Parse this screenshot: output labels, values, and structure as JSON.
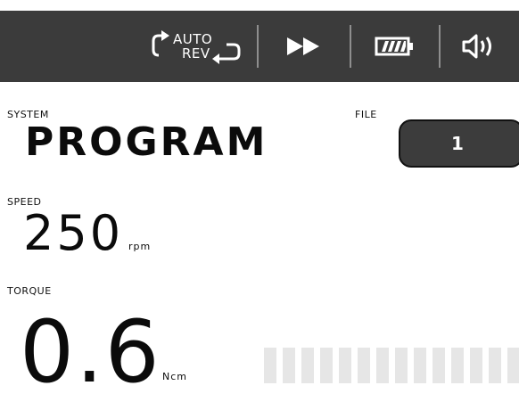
{
  "topbar": {
    "auto_label": "AUTO",
    "rev_label": "REV",
    "colors": {
      "bar": "#3b3b3b",
      "icon": "#ffffff",
      "divider": "#8e8e8e"
    },
    "icons": [
      "auto-reverse-icon",
      "fast-forward-icon",
      "battery-icon",
      "speaker-icon"
    ]
  },
  "system": {
    "label": "SYSTEM",
    "value": "PROGRAM"
  },
  "file": {
    "label": "FILE",
    "value": "1"
  },
  "speed": {
    "label": "SPEED",
    "value": "250",
    "unit": "rpm"
  },
  "torque": {
    "label": "TORQUE",
    "value": "0.6",
    "unit": "Ncm"
  },
  "torque_meter": {
    "segments_visible": 14,
    "segments_filled": 0,
    "colors": {
      "empty": "#e6e6e6"
    }
  }
}
